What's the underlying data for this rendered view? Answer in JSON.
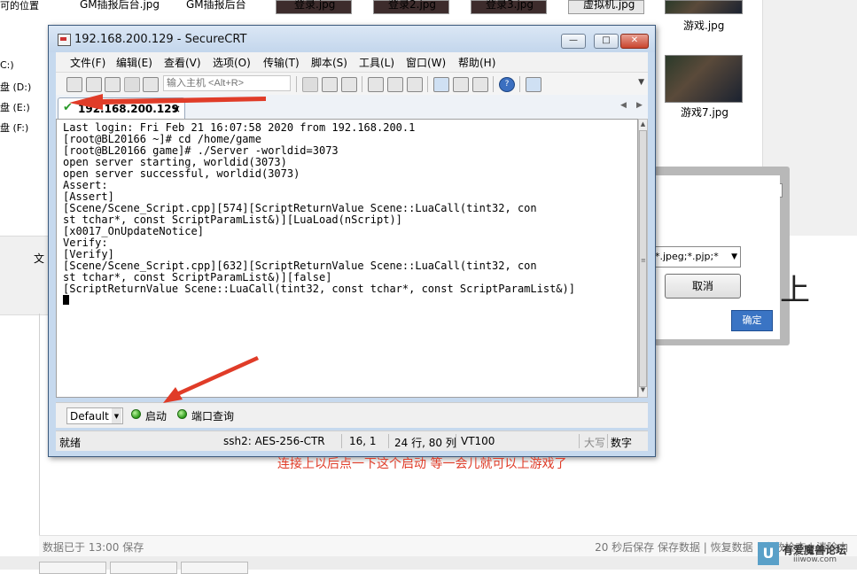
{
  "background": {
    "left_pane": {
      "top_text": "可的位置",
      "drives": [
        "C:)",
        "盘 (D:)",
        "盘 (E:)",
        "盘 (F:)"
      ],
      "strip_label": "文"
    },
    "explorer": {
      "top_labels": [
        "GM插报后台.jpg",
        "GM插报后台",
        "登录.jpg",
        "登录2.jpg",
        "登录3.jpg",
        "虚拟机.jpg"
      ],
      "right_images": [
        {
          "label": "游戏.jpg"
        },
        {
          "label": "游戏7.jpg"
        }
      ]
    },
    "file_dialog": {
      "filter_value": "*.jpeg;*.pjp;*",
      "cancel_label": "取消",
      "ok_label": "确定",
      "big_char": "上"
    },
    "editor_status": {
      "left": "数据已于 13:00 保存",
      "right": "20 秒后保存  保存数据 | 恢复数据 | 字数检查 | 清除内"
    },
    "watermark": {
      "brand": "有爱魔兽论坛",
      "url": "iiiwow.com",
      "logo_letter": "U"
    }
  },
  "securecrt": {
    "title": "192.168.200.129 - SecureCRT",
    "window_buttons": {
      "minimize": "—",
      "maximize": "□",
      "close": "✕"
    },
    "menu": [
      "文件(F)",
      "编辑(E)",
      "查看(V)",
      "选项(O)",
      "传输(T)",
      "脚本(S)",
      "工具(L)",
      "窗口(W)",
      "帮助(H)"
    ],
    "quick_connect_placeholder": "输入主机 <Alt+R>",
    "help_icon_glyph": "?",
    "tab": {
      "label": "192.168.200.129",
      "check": "✔",
      "close": "×"
    },
    "tab_nav": {
      "prev": "◀",
      "next": "▶"
    },
    "terminal_lines": [
      "Last login: Fri Feb 21 16:07:58 2020 from 192.168.200.1",
      "[root@BL20166 ~]# cd /home/game",
      "[root@BL20166 game]# ./Server -worldid=3073",
      "open server starting, worldid(3073)",
      "open server successful, worldid(3073)",
      "Assert:",
      "[Assert]",
      "[Scene/Scene_Script.cpp][574][ScriptReturnValue Scene::LuaCall(tint32, con",
      "st tchar*, const ScriptParamList&)][LuaLoad(nScript)]",
      "[x0017_OnUpdateNotice]",
      "Verify:",
      "[Verify]",
      "[Scene/Scene_Script.cpp][632][ScriptReturnValue Scene::LuaCall(tint32, con",
      "st tchar*, const ScriptParamList&)][false]",
      "[ScriptReturnValue Scene::LuaCall(tint32, const tchar*, const ScriptParamList&)]"
    ],
    "annotation": "连接上以后点一下这个启动  等一会儿就可以上游戏了",
    "annotation_color": "#e03c28",
    "button_bar": {
      "profile": "Default",
      "buttons": [
        "启动",
        "端口查询"
      ]
    },
    "status_bar": {
      "state": "就绪",
      "cipher": "ssh2: AES-256-CTR",
      "cursor_pos": "16,   1",
      "size": "24 行, 80 列",
      "emulation": "VT100",
      "caps": "大写",
      "num": "数字"
    }
  }
}
